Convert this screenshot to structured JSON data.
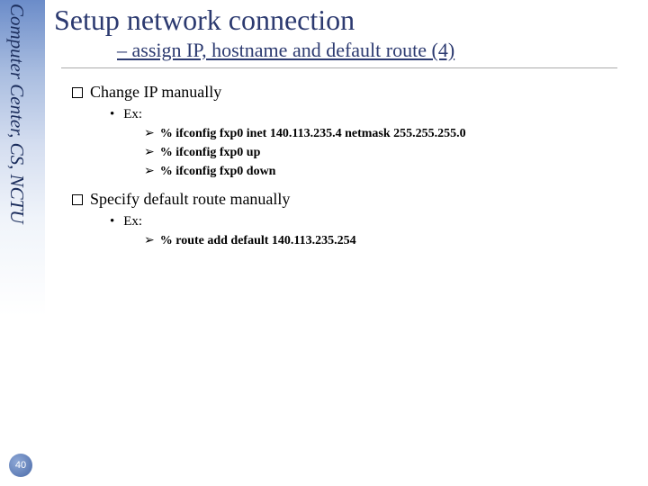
{
  "sidebar": {
    "org_text": "Computer Center, CS, NCTU",
    "page_number": "40"
  },
  "slide": {
    "title": "Setup network connection",
    "subtitle": "– assign IP, hostname and default route (4)",
    "section1": {
      "heading": "Change IP manually",
      "ex_label": "Ex:",
      "cmds": [
        "% ifconfig fxp0 inet 140.113.235.4 netmask 255.255.255.0",
        "% ifconfig fxp0 up",
        "% ifconfig fxp0 down"
      ]
    },
    "section2": {
      "heading": "Specify default route manually",
      "ex_label": "Ex:",
      "cmds": [
        "% route add default 140.113.235.254"
      ]
    }
  }
}
